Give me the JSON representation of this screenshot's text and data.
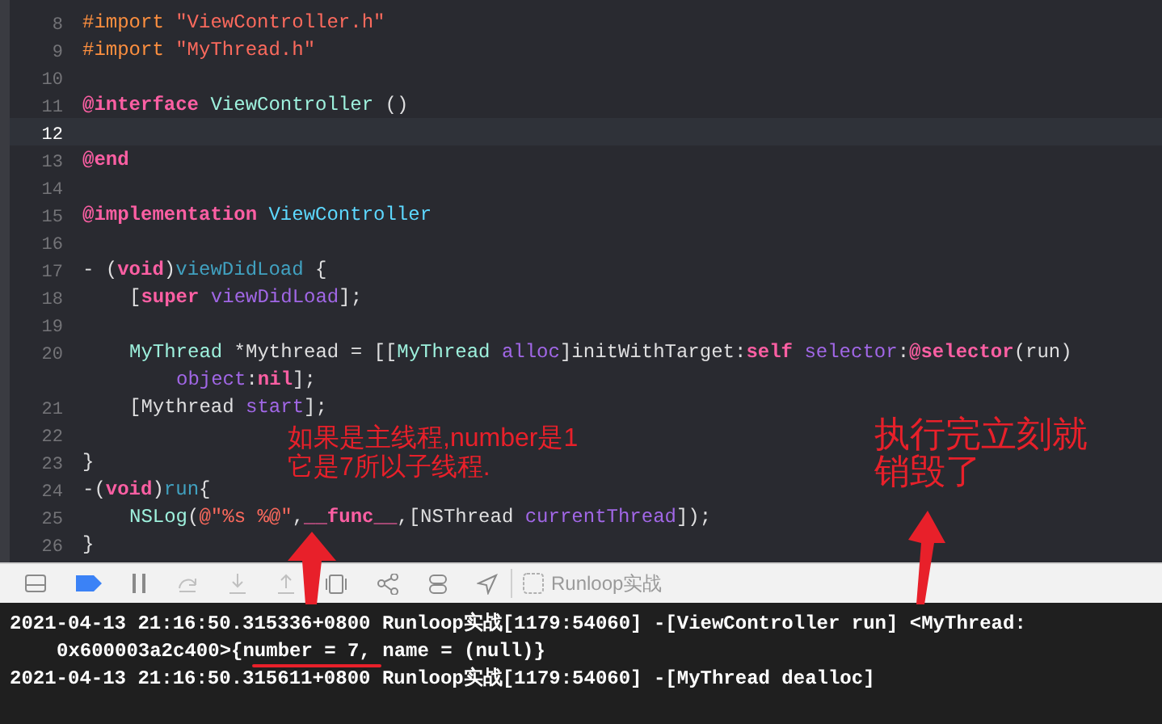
{
  "editor": {
    "lines": [
      {
        "number": "8",
        "current": false,
        "kind": "top",
        "tokens": [
          {
            "kind": "pp",
            "text": "#import "
          },
          {
            "kind": "str",
            "text": "\"ViewController.h\""
          }
        ]
      },
      {
        "number": "9",
        "current": false,
        "kind": "top",
        "tokens": [
          {
            "kind": "pp",
            "text": "#import "
          },
          {
            "kind": "str",
            "text": "\"MyThread.h\""
          }
        ]
      },
      {
        "number": "10",
        "current": false
      },
      {
        "number": "11",
        "current": false,
        "kind": "top",
        "tokens": [
          {
            "kind": "kw",
            "text": "@interface "
          },
          {
            "kind": "proj",
            "text": "ViewController "
          },
          {
            "kind": "plain",
            "text": "()"
          }
        ]
      },
      {
        "number": "12",
        "current": true
      },
      {
        "number": "13",
        "current": false,
        "kind": "top",
        "tokens": [
          {
            "kind": "kw",
            "text": "@end"
          }
        ]
      },
      {
        "number": "14",
        "current": false
      },
      {
        "number": "15",
        "current": false,
        "kind": "top",
        "tokens": [
          {
            "kind": "kw",
            "text": "@implementation "
          },
          {
            "kind": "decl",
            "text": "ViewController"
          }
        ]
      },
      {
        "number": "16",
        "current": false
      },
      {
        "number": "17",
        "current": false,
        "kind": "top",
        "tokens": [
          {
            "kind": "plain",
            "text": "- ("
          },
          {
            "kind": "kw",
            "text": "void"
          },
          {
            "kind": "plain",
            "text": ")"
          },
          {
            "kind": "func",
            "text": "viewDidLoad"
          },
          {
            "kind": "plain",
            "text": " {"
          }
        ]
      },
      {
        "number": "18",
        "current": false,
        "kind": "body",
        "tokens": [
          {
            "kind": "plain",
            "text": "["
          },
          {
            "kind": "kw",
            "text": "super "
          },
          {
            "kind": "method",
            "text": "viewDidLoad"
          },
          {
            "kind": "plain",
            "text": "];"
          }
        ]
      },
      {
        "number": "19",
        "current": false
      },
      {
        "number": "20",
        "current": false,
        "kind": "body",
        "tokens": [
          {
            "kind": "proj",
            "text": "MyThread"
          },
          {
            "kind": "plain",
            "text": " *Mythread = [["
          },
          {
            "kind": "proj",
            "text": "MyThread "
          },
          {
            "kind": "method",
            "text": "alloc"
          },
          {
            "kind": "plain",
            "text": "]initWithTarget:"
          },
          {
            "kind": "kw",
            "text": "self "
          },
          {
            "kind": "method",
            "text": "selector"
          },
          {
            "kind": "plain",
            "text": ":"
          },
          {
            "kind": "kw",
            "text": "@selector"
          },
          {
            "kind": "plain",
            "text": "(run)"
          }
        ],
        "wrapped": [
          {
            "kind": "method",
            "text": "object"
          },
          {
            "kind": "plain",
            "text": ":"
          },
          {
            "kind": "kw",
            "text": "nil"
          },
          {
            "kind": "plain",
            "text": "];"
          }
        ]
      },
      {
        "number": "21",
        "current": false,
        "kind": "body",
        "tokens": [
          {
            "kind": "plain",
            "text": "[Mythread "
          },
          {
            "kind": "method",
            "text": "start"
          },
          {
            "kind": "plain",
            "text": "];"
          }
        ]
      },
      {
        "number": "22",
        "current": false
      },
      {
        "number": "23",
        "current": false,
        "kind": "top",
        "tokens": [
          {
            "kind": "plain",
            "text": "}"
          }
        ]
      },
      {
        "number": "24",
        "current": false,
        "kind": "top",
        "tokens": [
          {
            "kind": "plain",
            "text": "-("
          },
          {
            "kind": "kw",
            "text": "void"
          },
          {
            "kind": "plain",
            "text": ")"
          },
          {
            "kind": "func",
            "text": "run"
          },
          {
            "kind": "plain",
            "text": "{"
          }
        ]
      },
      {
        "number": "25",
        "current": false,
        "kind": "body",
        "tokens": [
          {
            "kind": "proj",
            "text": "NSLog"
          },
          {
            "kind": "plain",
            "text": "("
          },
          {
            "kind": "str",
            "text": "@\"%s %@\""
          },
          {
            "kind": "plain",
            "text": ","
          },
          {
            "kind": "kw",
            "text": "__func__"
          },
          {
            "kind": "plain",
            "text": ",[NSThread "
          },
          {
            "kind": "method",
            "text": "currentThread"
          },
          {
            "kind": "plain",
            "text": "]);"
          }
        ]
      },
      {
        "number": "26",
        "current": false,
        "kind": "top",
        "tokens": [
          {
            "kind": "plain",
            "text": "}"
          }
        ]
      }
    ]
  },
  "debug_bar": {
    "target": "Runloop实战"
  },
  "console": {
    "lines": [
      "2021-04-13 21:16:50.315336+0800 Runloop实战[1179:54060] -[ViewController run] <MyThread:",
      "0x600003a2c400>{number = 7, name = (null)}",
      "2021-04-13 21:16:50.315611+0800 Runloop实战[1179:54060] -[MyThread dealloc]"
    ]
  },
  "annotations": [
    {
      "lines": [
        "如果是主线程,number是1",
        "它是7所以子线程."
      ]
    },
    {
      "lines": [
        "执行完立刻就",
        "销毁了"
      ]
    }
  ]
}
